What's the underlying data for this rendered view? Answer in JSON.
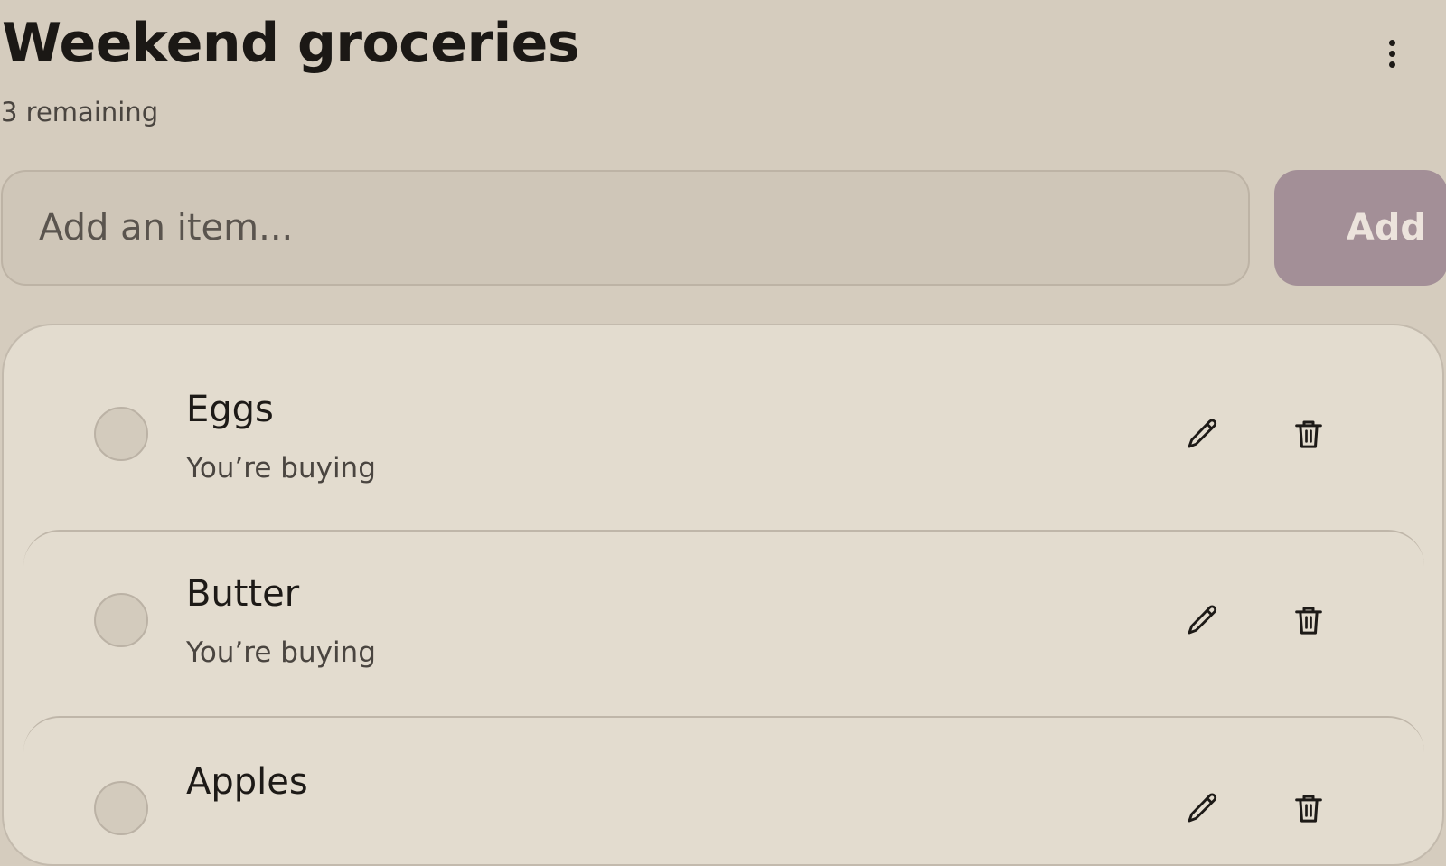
{
  "header": {
    "title": "Weekend groceries",
    "remaining": "3 remaining",
    "menu_icon": "more-vertical-icon"
  },
  "add_form": {
    "placeholder": "Add an item...",
    "value": "",
    "button_label": "Add"
  },
  "items": [
    {
      "name": "Eggs",
      "status": "You’re buying",
      "checked": false
    },
    {
      "name": "Butter",
      "status": "You’re buying",
      "checked": false
    },
    {
      "name": "Apples",
      "status": "",
      "checked": false
    }
  ],
  "icons": {
    "edit": "pencil-icon",
    "delete": "trash-icon",
    "check": "checkbox-circle-icon"
  },
  "colors": {
    "background": "#d5ccbe",
    "card": "#e3dccf",
    "accent": "#a38f97",
    "text": "#1d1a17"
  }
}
